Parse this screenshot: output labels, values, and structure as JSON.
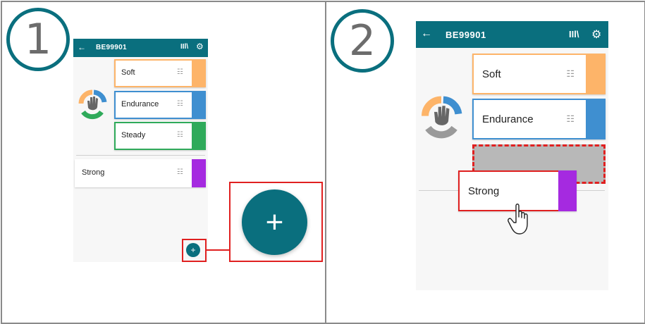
{
  "steps": {
    "step1": "1",
    "step2": "2"
  },
  "app": {
    "title": "BE99901",
    "back_icon": "←",
    "library_icon": "IIl\\",
    "settings_icon": "⚙"
  },
  "cards": {
    "soft": {
      "label": "Soft",
      "color": "#fdb469"
    },
    "endurance": {
      "label": "Endurance",
      "color": "#3f8fd0"
    },
    "steady": {
      "label": "Steady",
      "color": "#2faa5a"
    },
    "strong": {
      "label": "Strong",
      "color": "#a52ae0"
    }
  },
  "tune_icon": "☷",
  "fab": {
    "label": "+"
  },
  "highlight_color": "#e02020"
}
